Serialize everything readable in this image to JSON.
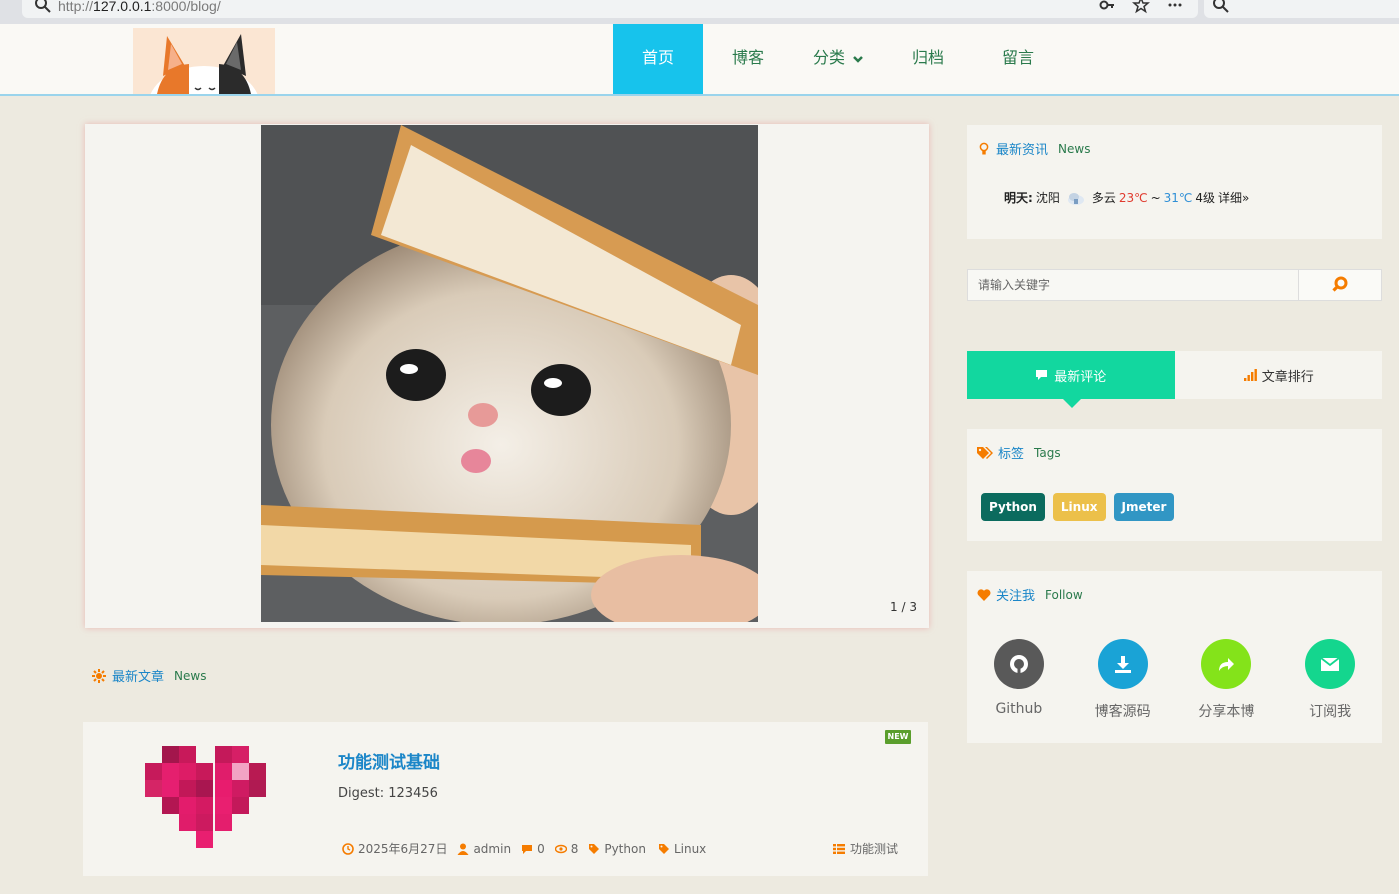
{
  "browser": {
    "url_prefix": "http://",
    "url_host": "127.0.0.1",
    "url_rest": ":8000/blog/"
  },
  "nav": {
    "items": [
      {
        "label": "首页",
        "active": true
      },
      {
        "label": "博客"
      },
      {
        "label": "分类"
      },
      {
        "label": "归档"
      },
      {
        "label": "留言"
      }
    ]
  },
  "carousel": {
    "counter": "1 / 3"
  },
  "latest": {
    "title": "最新文章",
    "subtitle": "News"
  },
  "article": {
    "badge": "NEW",
    "title": "功能测试基础",
    "digest": "Digest:  123456",
    "date": "2025年6月27日",
    "author": "admin",
    "comments": "0",
    "views": "8",
    "tag1": "Python",
    "tag2": "Linux",
    "category": "功能测试"
  },
  "sidebar": {
    "news": {
      "title": "最新资讯",
      "subtitle": "News",
      "day": "明天:",
      "city": "沈阳",
      "condition": "多云",
      "temp_high": "23℃",
      "sep": "~",
      "temp_low": "31℃",
      "wind": "4级",
      "detail": "详细»"
    },
    "search": {
      "placeholder": "请输入关键字"
    },
    "tabs": {
      "comments": "最新评论",
      "ranking": "文章排行"
    },
    "tags": {
      "title": "标签",
      "subtitle": "Tags",
      "items": [
        {
          "label": "Python",
          "color": "#0b6b5e"
        },
        {
          "label": "Linux",
          "color": "#ecc04a"
        },
        {
          "label": "Jmeter",
          "color": "#3196c4"
        }
      ]
    },
    "follow": {
      "title": "关注我",
      "subtitle": "Follow",
      "items": [
        {
          "label": "Github",
          "color": "#595959",
          "icon": "github-icon"
        },
        {
          "label": "博客源码",
          "color": "#1aa3d6",
          "icon": "download-icon"
        },
        {
          "label": "分享本博",
          "color": "#84e31a",
          "icon": "share-icon"
        },
        {
          "label": "订阅我",
          "color": "#14d68e",
          "icon": "mail-icon"
        }
      ]
    }
  },
  "colors": {
    "accent_blue": "#17c3ec",
    "accent_green": "#12d79f",
    "orange": "#f57c00"
  }
}
